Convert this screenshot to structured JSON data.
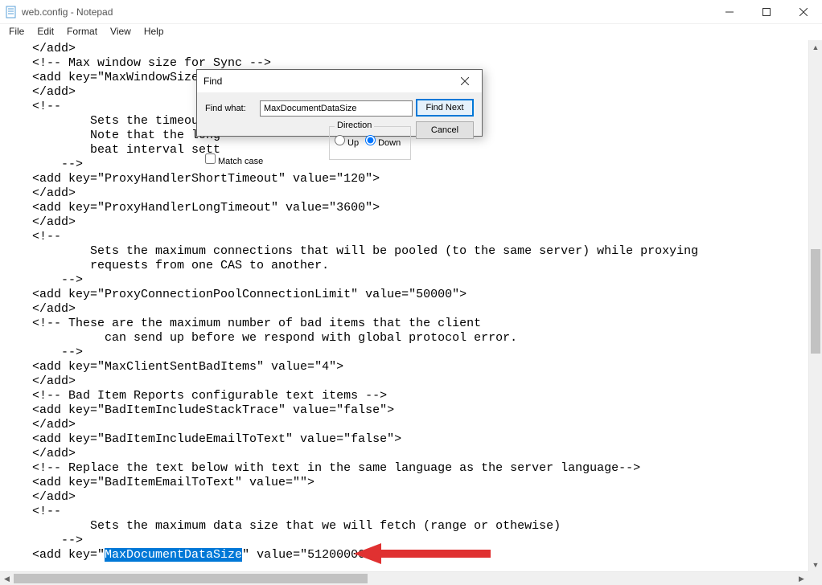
{
  "titlebar": {
    "title": "web.config - Notepad"
  },
  "menus": {
    "file": "File",
    "edit": "Edit",
    "format": "Format",
    "view": "View",
    "help": "Help"
  },
  "find": {
    "title": "Find",
    "label_findwhat": "Find what:",
    "value": "MaxDocumentDataSize",
    "btn_findnext": "Find Next",
    "btn_cancel": "Cancel",
    "direction_label": "Direction",
    "dir_up": "Up",
    "dir_down": "Down",
    "matchcase": "Match case"
  },
  "lines": [
    "    </add>",
    "    <!-- Max window size for Sync -->",
    "    <add key=\"MaxWindowSize\" value=\"100\">",
    "    </add>",
    "    <!--",
    "            Sets the timeout v",
    "            Note that the long",
    "            beat interval sett",
    "        -->",
    "    <add key=\"ProxyHandlerShortTimeout\" value=\"120\">",
    "    </add>",
    "    <add key=\"ProxyHandlerLongTimeout\" value=\"3600\">",
    "    </add>",
    "    <!--",
    "            Sets the maximum connections that will be pooled (to the same server) while proxying",
    "            requests from one CAS to another.",
    "        -->",
    "    <add key=\"ProxyConnectionPoolConnectionLimit\" value=\"50000\">",
    "    </add>",
    "    <!-- These are the maximum number of bad items that the client",
    "              can send up before we respond with global protocol error.",
    "        -->",
    "    <add key=\"MaxClientSentBadItems\" value=\"4\">",
    "    </add>",
    "    <!-- Bad Item Reports configurable text items -->",
    "    <add key=\"BadItemIncludeStackTrace\" value=\"false\">",
    "    </add>",
    "    <add key=\"BadItemIncludeEmailToText\" value=\"false\">",
    "    </add>",
    "    <!-- Replace the text below with text in the same language as the server language-->",
    "    <add key=\"BadItemEmailToText\" value=\"\">",
    "    </add>",
    "    <!--",
    "            Sets the maximum data size that we will fetch (range or othewise)",
    "        -->"
  ],
  "highlight_line": {
    "prefix": "    <add key=\"",
    "highlight": "MaxDocumentDataSize",
    "suffix": "\" value=\"51200000\">"
  }
}
